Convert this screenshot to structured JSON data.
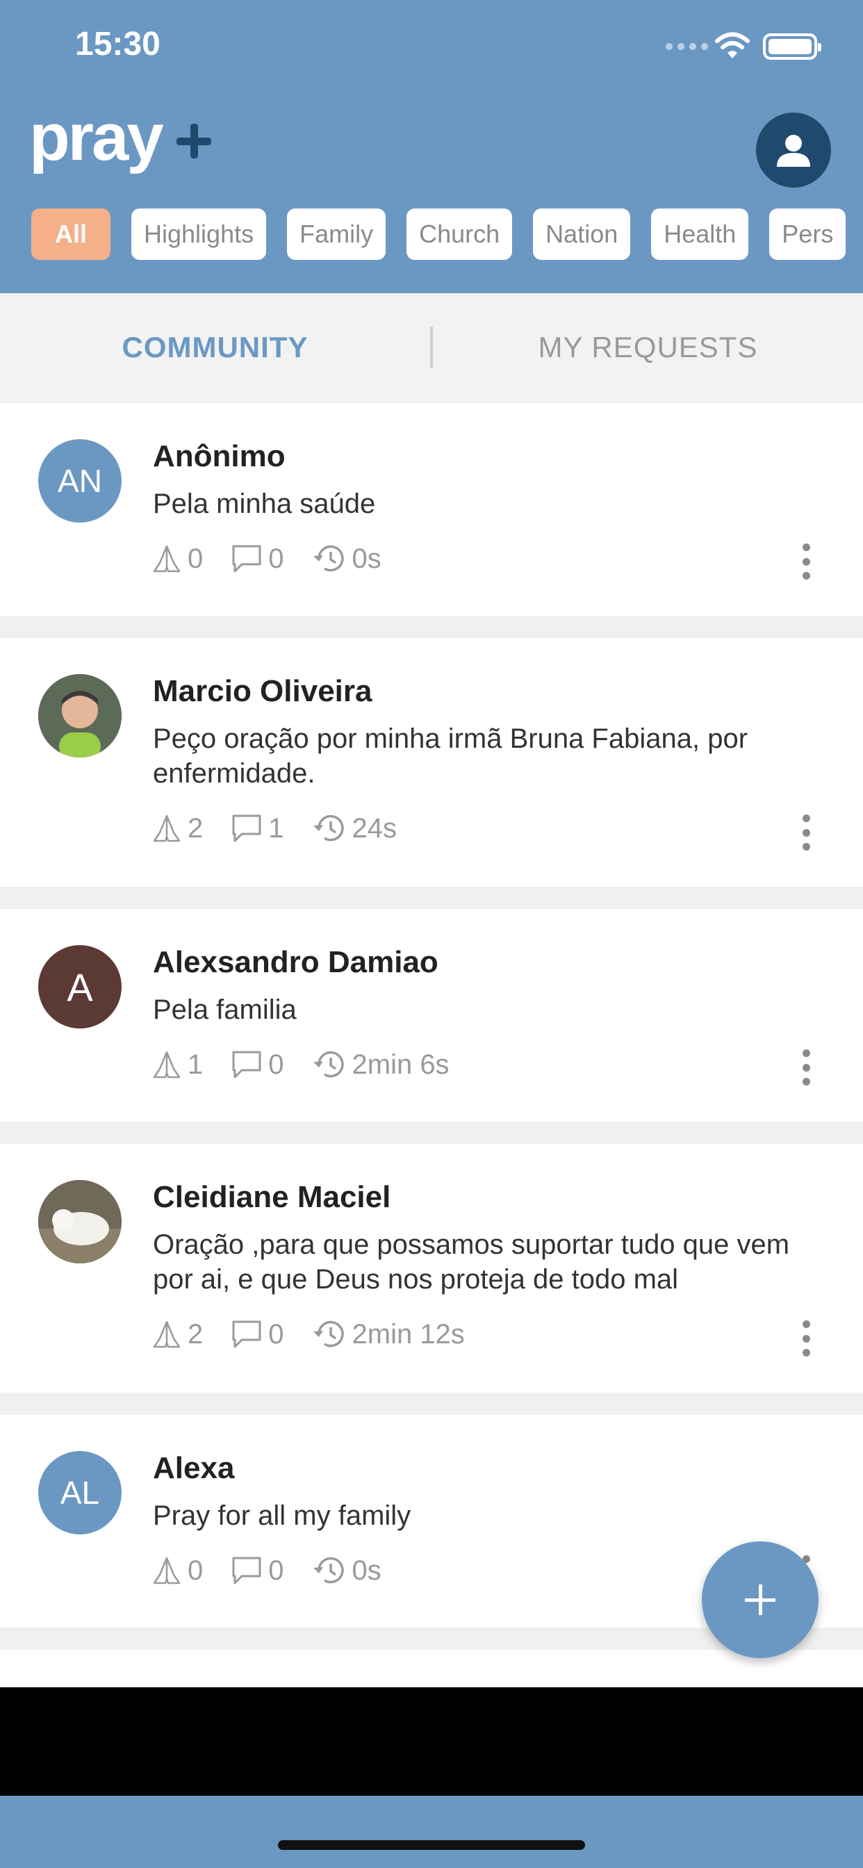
{
  "status_bar": {
    "time": "15:30"
  },
  "header": {
    "logo": "pray",
    "chips": [
      "All",
      "Highlights",
      "Family",
      "Church",
      "Nation",
      "Health",
      "Pers"
    ]
  },
  "tabs": {
    "community": "COMMUNITY",
    "my_requests": "MY REQUESTS"
  },
  "posts": [
    {
      "initials": "AN",
      "avatar_color": "#6b98c3",
      "name": "Anônimo",
      "text": "Pela minha saúde",
      "prayers": "0",
      "comments": "0",
      "time": "0s"
    },
    {
      "initials": "",
      "avatar_color": "#7a8a6a",
      "name": "Marcio Oliveira",
      "text": "Peço oração por minha irmã Bruna Fabiana, por enfermidade.",
      "prayers": "2",
      "comments": "1",
      "time": "24s"
    },
    {
      "initials": "A",
      "avatar_color": "#5b3a33",
      "name": "Alexsandro Damiao",
      "text": "Pela familia",
      "prayers": "1",
      "comments": "0",
      "time": "2min 6s"
    },
    {
      "initials": "",
      "avatar_color": "#6f6a58",
      "name": "Cleidiane Maciel",
      "text": "Oração ,para que possamos suportar tudo que vem por ai, e que Deus nos proteja de todo mal",
      "prayers": "2",
      "comments": "0",
      "time": "2min 12s"
    },
    {
      "initials": "AL",
      "avatar_color": "#6b98c3",
      "name": "Alexa",
      "text": "Pray for all my family",
      "prayers": "0",
      "comments": "0",
      "time": "0s"
    }
  ],
  "colors": {
    "primary": "#6b98c3",
    "accent": "#f5b08a",
    "dark": "#1f4a6e"
  }
}
